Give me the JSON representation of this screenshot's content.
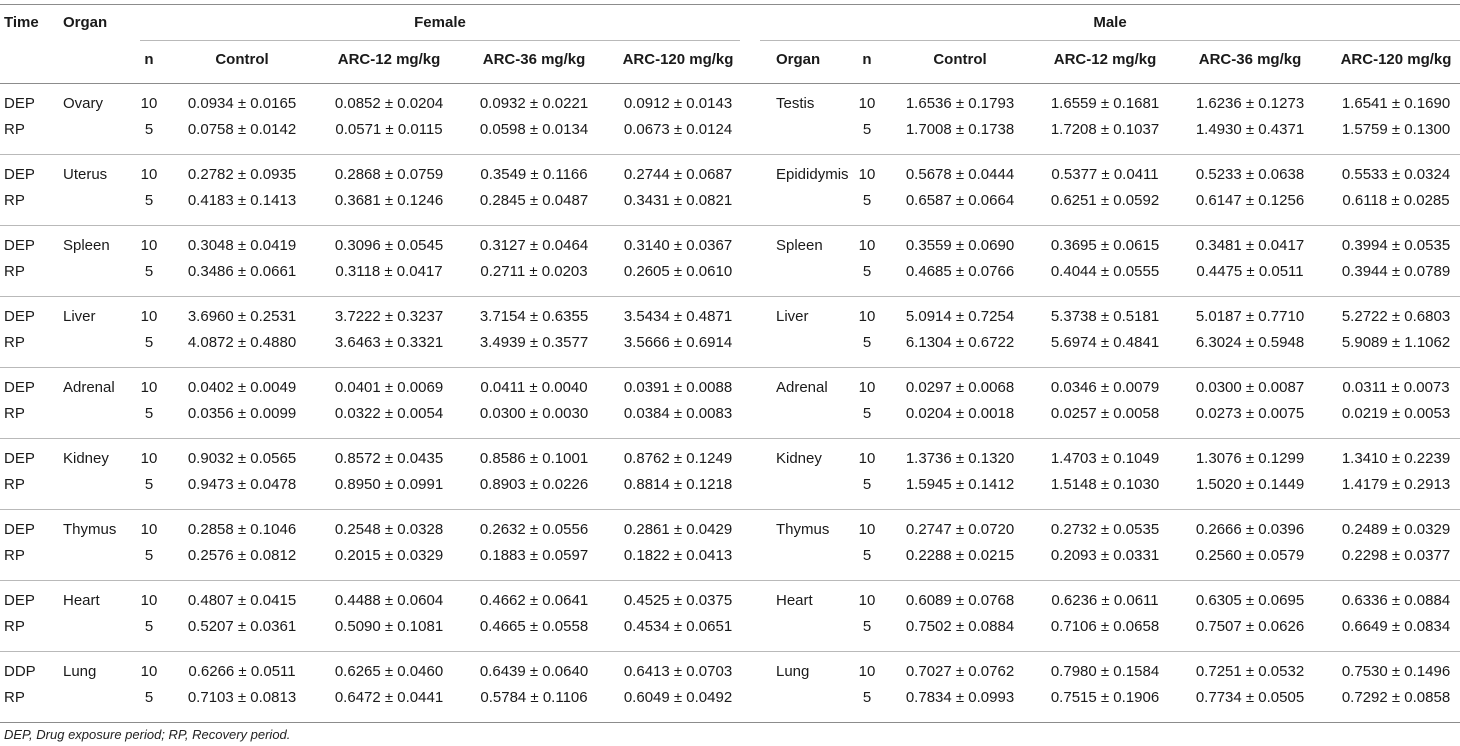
{
  "header": {
    "time": "Time",
    "organ": "Organ",
    "female": "Female",
    "male": "Male",
    "n": "n",
    "groups": [
      "Control",
      "ARC-12 mg/kg",
      "ARC-36 mg/kg",
      "ARC-120 mg/kg"
    ]
  },
  "rows": [
    {
      "fo": "Ovary",
      "mo": "Testis",
      "sub": [
        {
          "t": "DEP",
          "n": "10",
          "f": [
            "0.0934 ± 0.0165",
            "0.0852 ± 0.0204",
            "0.0932 ± 0.0221",
            "0.0912 ± 0.0143"
          ],
          "m": [
            "1.6536 ± 0.1793",
            "1.6559 ± 0.1681",
            "1.6236 ± 0.1273",
            "1.6541 ± 0.1690"
          ]
        },
        {
          "t": "RP",
          "n": "5",
          "f": [
            "0.0758 ± 0.0142",
            "0.0571 ± 0.0115",
            "0.0598 ± 0.0134",
            "0.0673 ± 0.0124"
          ],
          "m": [
            "1.7008 ± 0.1738",
            "1.7208 ± 0.1037",
            "1.4930 ± 0.4371",
            "1.5759 ± 0.1300"
          ]
        }
      ]
    },
    {
      "fo": "Uterus",
      "mo": "Epididymis",
      "sub": [
        {
          "t": "DEP",
          "n": "10",
          "f": [
            "0.2782 ± 0.0935",
            "0.2868 ± 0.0759",
            "0.3549 ± 0.1166",
            "0.2744 ± 0.0687"
          ],
          "m": [
            "0.5678 ± 0.0444",
            "0.5377 ± 0.0411",
            "0.5233 ± 0.0638",
            "0.5533 ± 0.0324"
          ]
        },
        {
          "t": "RP",
          "n": "5",
          "f": [
            "0.4183 ± 0.1413",
            "0.3681 ± 0.1246",
            "0.2845 ± 0.0487",
            "0.3431 ± 0.0821"
          ],
          "m": [
            "0.6587 ± 0.0664",
            "0.6251 ± 0.0592",
            "0.6147 ± 0.1256",
            "0.6118 ± 0.0285"
          ]
        }
      ]
    },
    {
      "fo": "Spleen",
      "mo": "Spleen",
      "sub": [
        {
          "t": "DEP",
          "n": "10",
          "f": [
            "0.3048 ± 0.0419",
            "0.3096 ± 0.0545",
            "0.3127 ± 0.0464",
            "0.3140 ± 0.0367"
          ],
          "m": [
            "0.3559 ± 0.0690",
            "0.3695 ± 0.0615",
            "0.3481 ± 0.0417",
            "0.3994 ± 0.0535"
          ]
        },
        {
          "t": "RP",
          "n": "5",
          "f": [
            "0.3486 ± 0.0661",
            "0.3118 ± 0.0417",
            "0.2711 ± 0.0203",
            "0.2605 ± 0.0610"
          ],
          "m": [
            "0.4685 ± 0.0766",
            "0.4044 ± 0.0555",
            "0.4475 ± 0.0511",
            "0.3944 ± 0.0789"
          ]
        }
      ]
    },
    {
      "fo": "Liver",
      "mo": "Liver",
      "sub": [
        {
          "t": "DEP",
          "n": "10",
          "f": [
            "3.6960 ± 0.2531",
            "3.7222 ± 0.3237",
            "3.7154 ± 0.6355",
            "3.5434 ± 0.4871"
          ],
          "m": [
            "5.0914 ± 0.7254",
            "5.3738 ± 0.5181",
            "5.0187 ± 0.7710",
            "5.2722 ± 0.6803"
          ]
        },
        {
          "t": "RP",
          "n": "5",
          "f": [
            "4.0872 ± 0.4880",
            "3.6463 ± 0.3321",
            "3.4939 ± 0.3577",
            "3.5666 ± 0.6914"
          ],
          "m": [
            "6.1304 ± 0.6722",
            "5.6974 ± 0.4841",
            "6.3024 ± 0.5948",
            "5.9089 ± 1.1062"
          ]
        }
      ]
    },
    {
      "fo": "Adrenal",
      "mo": "Adrenal",
      "sub": [
        {
          "t": "DEP",
          "n": "10",
          "f": [
            "0.0402 ± 0.0049",
            "0.0401 ± 0.0069",
            "0.0411 ± 0.0040",
            "0.0391 ± 0.0088"
          ],
          "m": [
            "0.0297 ± 0.0068",
            "0.0346 ± 0.0079",
            "0.0300 ± 0.0087",
            "0.0311 ± 0.0073"
          ]
        },
        {
          "t": "RP",
          "n": "5",
          "f": [
            "0.0356 ± 0.0099",
            "0.0322 ± 0.0054",
            "0.0300 ± 0.0030",
            "0.0384 ± 0.0083"
          ],
          "m": [
            "0.0204 ± 0.0018",
            "0.0257 ± 0.0058",
            "0.0273 ± 0.0075",
            "0.0219 ± 0.0053"
          ]
        }
      ]
    },
    {
      "fo": "Kidney",
      "mo": "Kidney",
      "sub": [
        {
          "t": "DEP",
          "n": "10",
          "f": [
            "0.9032 ± 0.0565",
            "0.8572 ± 0.0435",
            "0.8586 ± 0.1001",
            "0.8762 ± 0.1249"
          ],
          "m": [
            "1.3736 ± 0.1320",
            "1.4703 ± 0.1049",
            "1.3076 ± 0.1299",
            "1.3410 ± 0.2239"
          ]
        },
        {
          "t": "RP",
          "n": "5",
          "f": [
            "0.9473 ± 0.0478",
            "0.8950 ± 0.0991",
            "0.8903 ± 0.0226",
            "0.8814 ± 0.1218"
          ],
          "m": [
            "1.5945 ± 0.1412",
            "1.5148 ± 0.1030",
            "1.5020 ± 0.1449",
            "1.4179 ± 0.2913"
          ]
        }
      ]
    },
    {
      "fo": "Thymus",
      "mo": "Thymus",
      "sub": [
        {
          "t": "DEP",
          "n": "10",
          "f": [
            "0.2858 ± 0.1046",
            "0.2548 ± 0.0328",
            "0.2632 ± 0.0556",
            "0.2861 ± 0.0429"
          ],
          "m": [
            "0.2747 ± 0.0720",
            "0.2732 ± 0.0535",
            "0.2666 ± 0.0396",
            "0.2489 ± 0.0329"
          ]
        },
        {
          "t": "RP",
          "n": "5",
          "f": [
            "0.2576 ± 0.0812",
            "0.2015 ± 0.0329",
            "0.1883 ± 0.0597",
            "0.1822 ± 0.0413"
          ],
          "m": [
            "0.2288 ± 0.0215",
            "0.2093 ± 0.0331",
            "0.2560 ± 0.0579",
            "0.2298 ± 0.0377"
          ]
        }
      ]
    },
    {
      "fo": "Heart",
      "mo": "Heart",
      "sub": [
        {
          "t": "DEP",
          "n": "10",
          "f": [
            "0.4807 ± 0.0415",
            "0.4488 ± 0.0604",
            "0.4662 ± 0.0641",
            "0.4525 ± 0.0375"
          ],
          "m": [
            "0.6089 ± 0.0768",
            "0.6236 ± 0.0611",
            "0.6305 ± 0.0695",
            "0.6336 ± 0.0884"
          ]
        },
        {
          "t": "RP",
          "n": "5",
          "f": [
            "0.5207 ± 0.0361",
            "0.5090 ± 0.1081",
            "0.4665 ± 0.0558",
            "0.4534 ± 0.0651"
          ],
          "m": [
            "0.7502 ± 0.0884",
            "0.7106 ± 0.0658",
            "0.7507 ± 0.0626",
            "0.6649 ± 0.0834"
          ]
        }
      ]
    },
    {
      "fo": "Lung",
      "mo": "Lung",
      "sub": [
        {
          "t": "DDP",
          "n": "10",
          "f": [
            "0.6266 ± 0.0511",
            "0.6265 ± 0.0460",
            "0.6439 ± 0.0640",
            "0.6413 ± 0.0703"
          ],
          "m": [
            "0.7027 ± 0.0762",
            "0.7980 ± 0.1584",
            "0.7251 ± 0.0532",
            "0.7530 ± 0.1496"
          ]
        },
        {
          "t": "RP",
          "n": "5",
          "f": [
            "0.7103 ± 0.0813",
            "0.6472 ± 0.0441",
            "0.5784 ± 0.1106",
            "0.6049 ± 0.0492"
          ],
          "m": [
            "0.7834 ± 0.0993",
            "0.7515 ± 0.1906",
            "0.7734 ± 0.0505",
            "0.7292 ± 0.0858"
          ]
        }
      ]
    }
  ],
  "footnote": "DEP, Drug exposure period; RP, Recovery period."
}
